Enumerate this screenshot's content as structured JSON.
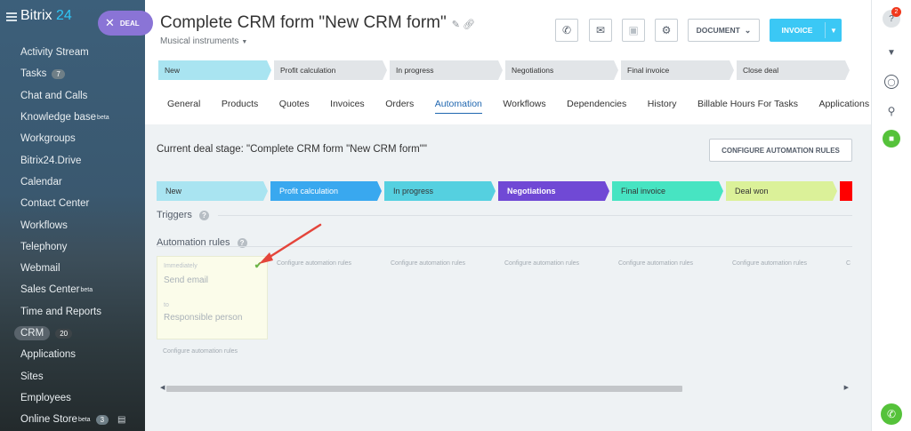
{
  "sidebar": {
    "logo_prefix": "Bitrix",
    "logo_num": "24",
    "deal_button": "DEAL",
    "items": [
      {
        "label": "Activity Stream"
      },
      {
        "label": "Tasks",
        "badge": "7"
      },
      {
        "label": "Chat and Calls"
      },
      {
        "label": "Knowledge base",
        "sup": "beta"
      },
      {
        "label": "Workgroups"
      },
      {
        "label": "Bitrix24.Drive"
      },
      {
        "label": "Calendar"
      },
      {
        "label": "Contact Center"
      },
      {
        "label": "Workflows"
      },
      {
        "label": "Telephony"
      },
      {
        "label": "Webmail"
      },
      {
        "label": "Sales Center",
        "sup": "beta"
      },
      {
        "label": "Time and Reports"
      },
      {
        "label": "CRM",
        "badge": "20"
      },
      {
        "label": "Applications"
      },
      {
        "label": "Sites"
      },
      {
        "label": "Employees"
      },
      {
        "label": "Online Store",
        "sup": "beta",
        "badge": "3"
      }
    ]
  },
  "header": {
    "title": "Complete CRM form \"New CRM form\"",
    "subtitle": "Musical instruments",
    "document_button": "DOCUMENT",
    "invoice_button": "INVOICE"
  },
  "top_stages": [
    {
      "label": "New",
      "color": "#a9e4f1"
    },
    {
      "label": "Profit calculation",
      "color": "#e2e5e8"
    },
    {
      "label": "In progress",
      "color": "#e2e5e8"
    },
    {
      "label": "Negotiations",
      "color": "#e2e5e8"
    },
    {
      "label": "Final invoice",
      "color": "#e2e5e8"
    },
    {
      "label": "Close deal",
      "color": "#e2e5e8"
    }
  ],
  "tabs": [
    {
      "label": "General"
    },
    {
      "label": "Products"
    },
    {
      "label": "Quotes"
    },
    {
      "label": "Invoices"
    },
    {
      "label": "Orders"
    },
    {
      "label": "Automation",
      "active": true
    },
    {
      "label": "Workflows"
    },
    {
      "label": "Dependencies"
    },
    {
      "label": "History"
    },
    {
      "label": "Billable Hours For Tasks"
    },
    {
      "label": "Applications"
    }
  ],
  "automation": {
    "current_stage": "Current deal stage: \"Complete CRM form \"New CRM form\"\"",
    "configure_button": "CONFIGURE AUTOMATION RULES",
    "stages": [
      {
        "label": "New",
        "color": "#a9e4f1",
        "text_color": "#333333"
      },
      {
        "label": "Profit calculation",
        "color": "#39a8ef",
        "text_color": "#ffffff"
      },
      {
        "label": "In progress",
        "color": "#55d0e0",
        "text_color": "#333333"
      },
      {
        "label": "Negotiations",
        "color": "#7049d5",
        "text_color": "#ffffff"
      },
      {
        "label": "Final invoice",
        "color": "#47e4c2",
        "text_color": "#333333"
      },
      {
        "label": "Deal won",
        "color": "#dbf199",
        "text_color": "#333333"
      },
      {
        "label": "",
        "color": "#ff0000",
        "text_color": "#ffffff"
      }
    ],
    "triggers_label": "Triggers",
    "rules_label": "Automation rules",
    "rule": {
      "when": "Immediately",
      "action": "Send email",
      "to_label": "to",
      "recipient": "Responsible person"
    },
    "configure_link": "Configure automation rules",
    "configure_link_cut": "C"
  },
  "right_panel": {
    "notification_count": "2"
  },
  "colors": {
    "accent": "#3bc8f5",
    "active_tab": "#2067b0",
    "arrow": "#e4453b",
    "check": "#6cb648"
  }
}
